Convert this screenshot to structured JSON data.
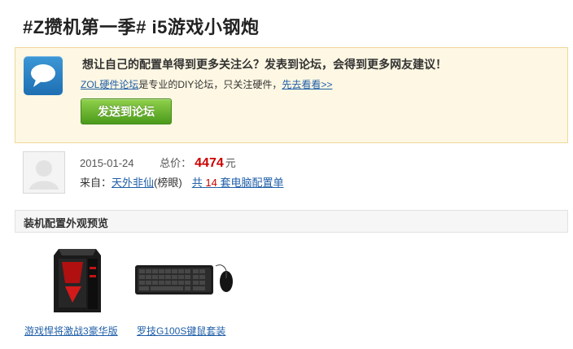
{
  "header": {
    "title": "#Z攒机第一季# i5游戏小钢炮"
  },
  "promo": {
    "icon": "speech-bubble-icon",
    "heading": "想让自己的配置单得到更多关注么？发表到论坛，会得到更多网友建议！",
    "forum_link": "ZOL硬件论坛",
    "forum_desc": "是专业的DIY论坛，只关注硬件，",
    "look_link": "先去看看>>",
    "button_label": "发送到论坛"
  },
  "author": {
    "avatar": "default-avatar-icon",
    "date": "2015-01-24",
    "price_label": "总价：",
    "price": "4474",
    "price_unit": "元",
    "from_label": "来自：",
    "name": "天外非仙",
    "rank": "(榜眼)",
    "count_prefix": "共",
    "count": "14",
    "count_suffix": "套电脑配置单"
  },
  "section": {
    "title": "装机配置外观预览"
  },
  "products": [
    {
      "caption": "游戏悍将激战3豪华版",
      "icon": "pc-case-icon"
    },
    {
      "caption": "罗技G100S键鼠套装",
      "icon": "keyboard-mouse-icon"
    }
  ],
  "colors": {
    "accent_link": "#1f5fa8",
    "price_red": "#cc0000",
    "button_green": "#5fae2a",
    "promo_bg": "#fdf7e3"
  }
}
